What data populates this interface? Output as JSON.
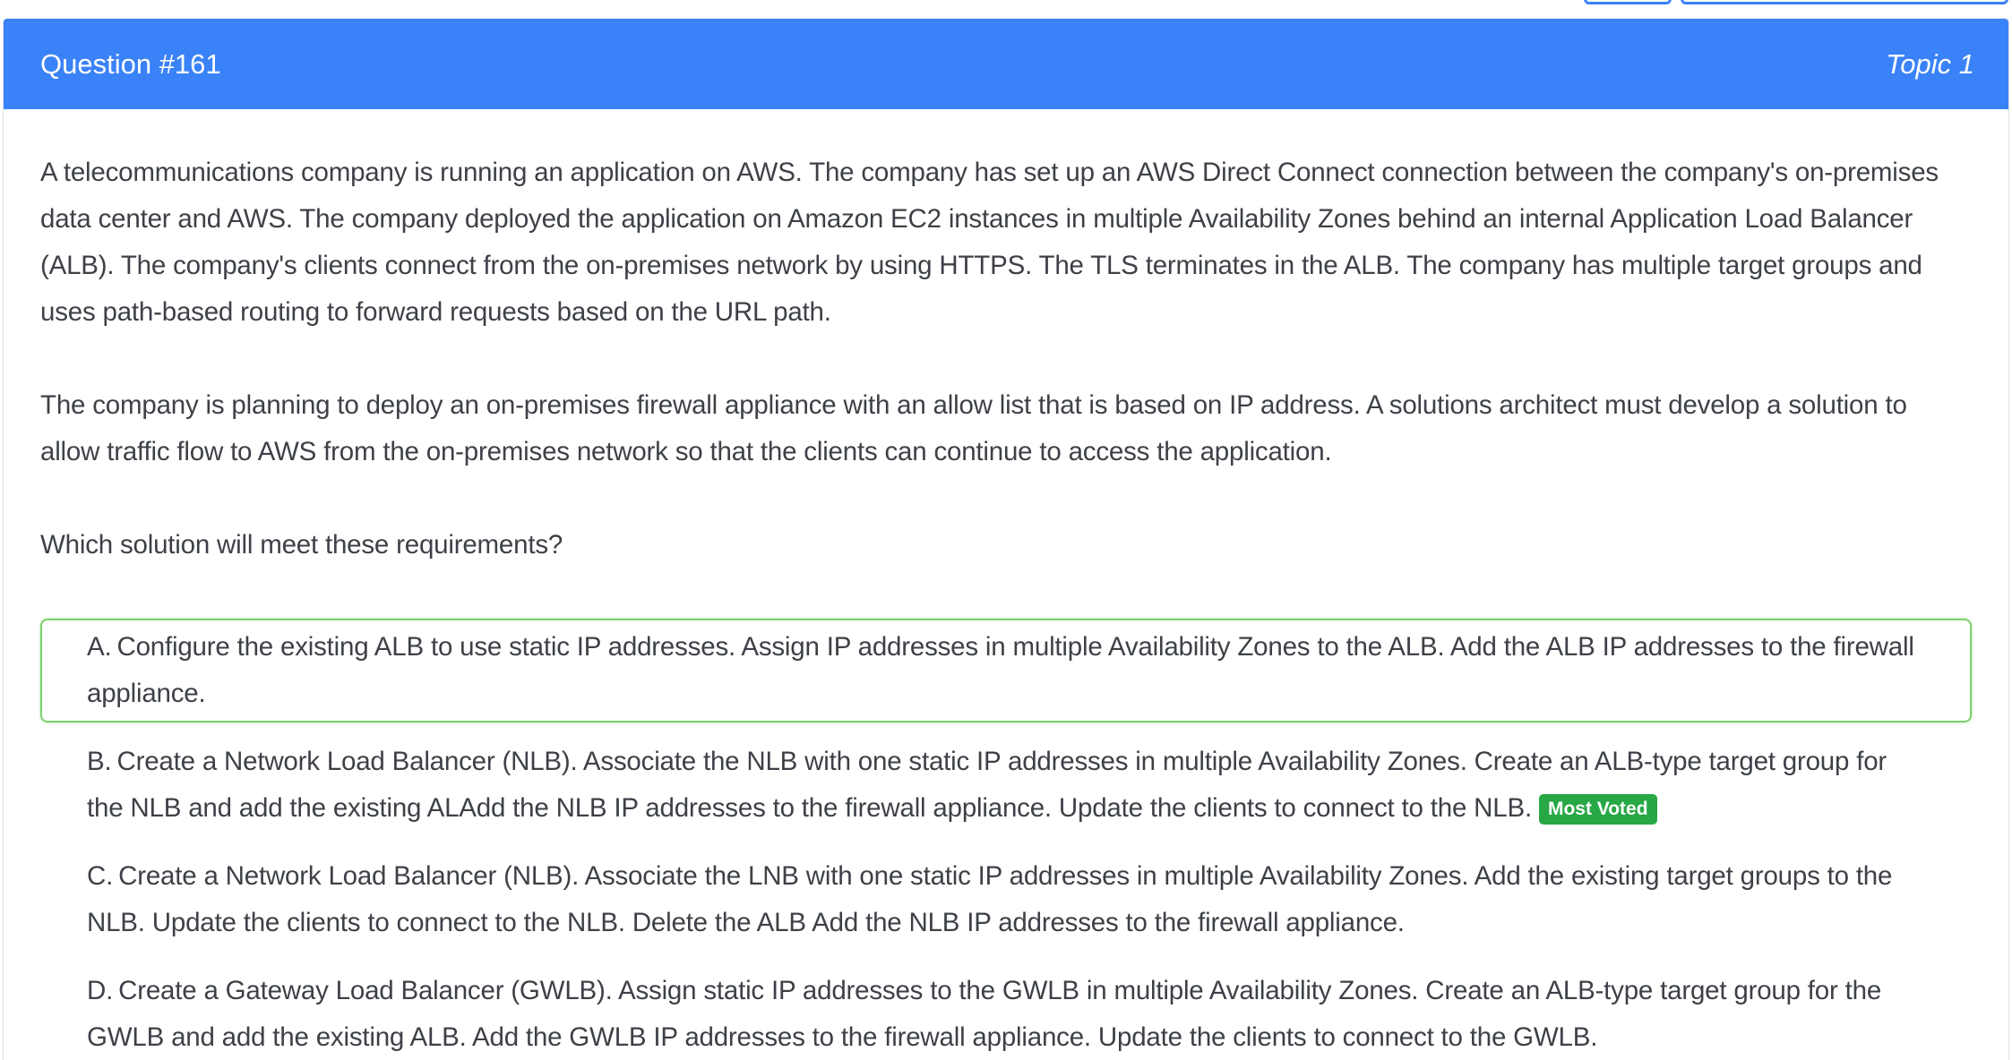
{
  "header": {
    "question_number": "Question #161",
    "topic": "Topic 1",
    "background_color": "#3a82f7"
  },
  "question": {
    "paragraphs": [
      "A telecommunications company is running an application on AWS. The company has set up an AWS Direct Connect connection between the company's on-premises data center and AWS. The company deployed the application on Amazon EC2 instances in multiple Availability Zones behind an internal Application Load Balancer (ALB). The company's clients connect from the on-premises network by using HTTPS. The TLS terminates in the ALB. The company has multiple target groups and uses path-based routing to forward requests based on the URL path.",
      "The company is planning to deploy an on-premises firewall appliance with an allow list that is based on IP address. A solutions architect must develop a solution to allow traffic flow to AWS from the on-premises network so that the clients can continue to access the application.",
      "Which solution will meet these requirements?"
    ]
  },
  "choices": [
    {
      "letter": "A.",
      "text": "Configure the existing ALB to use static IP addresses. Assign IP addresses in multiple Availability Zones to the ALB. Add the ALB IP addresses to the firewall appliance.",
      "highlighted": true
    },
    {
      "letter": "B.",
      "text": "Create a Network Load Balancer (NLB). Associate the NLB with one static IP addresses in multiple Availability Zones. Create an ALB-type target group for the NLB and add the existing ALAdd the NLB IP addresses to the firewall appliance. Update the clients to connect to the NLB.",
      "badge": "Most Voted"
    },
    {
      "letter": "C.",
      "text": "Create a Network Load Balancer (NLB). Associate the LNB with one static IP addresses in multiple Availability Zones. Add the existing target groups to the NLB. Update the clients to connect to the NLB. Delete the ALB Add the NLB IP addresses to the firewall appliance."
    },
    {
      "letter": "D.",
      "text": "Create a Gateway Load Balancer (GWLB). Assign static IP addresses to the GWLB in multiple Availability Zones. Create an ALB-type target group for the GWLB and add the existing ALB. Add the GWLB IP addresses to the firewall appliance. Update the clients to connect to the GWLB."
    }
  ],
  "colors": {
    "highlight_border": "#7bd36b",
    "badge_background": "#28a745",
    "text": "#3d4147"
  }
}
